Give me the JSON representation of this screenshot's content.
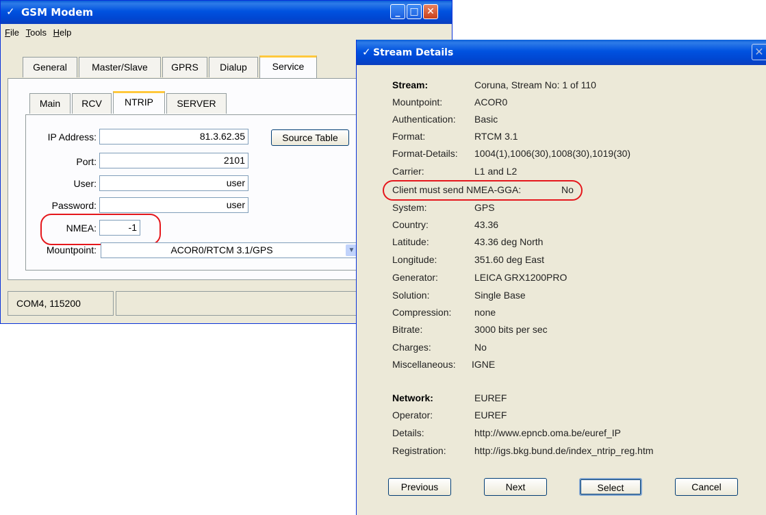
{
  "modem": {
    "title": "GSM Modem",
    "menu": [
      "File",
      "Tools",
      "Help"
    ],
    "tabs": [
      "General",
      "Master/Slave",
      "GPRS",
      "Dialup",
      "Service"
    ],
    "subtabs": [
      "Main",
      "RCV",
      "NTRIP",
      "SERVER"
    ],
    "ip_label": "IP Address:",
    "ip_value": "81.3.62.35",
    "source_table_label": "Source Table",
    "port_label": "Port:",
    "port_value": "2101",
    "user_label": "User:",
    "user_value": "user",
    "password_label": "Password:",
    "password_value": "user",
    "nmea_label": "NMEA:",
    "nmea_value": "-1",
    "mountpoint_label": "Mountpoint:",
    "mountpoint_value": "ACOR0/RTCM 3.1/GPS",
    "status": "COM4, 115200"
  },
  "stream": {
    "title": "Stream Details",
    "rows": [
      {
        "k": "Stream:",
        "v": "Coruna, Stream No:  1 of 110"
      },
      {
        "k": "Mountpoint:",
        "v": "ACOR0"
      },
      {
        "k": "Authentication:",
        "v": "Basic"
      },
      {
        "k": "Format:",
        "v": "RTCM 3.1"
      },
      {
        "k": "Format-Details:",
        "v": "1004(1),1006(30),1008(30),1019(30)"
      },
      {
        "k": "Carrier:",
        "v": "L1 and L2"
      },
      {
        "k": "Client must send NMEA-GGA:",
        "v": "No"
      },
      {
        "k": "System:",
        "v": "GPS"
      },
      {
        "k": "Country:",
        "v": "43.36"
      },
      {
        "k": "Latitude:",
        "v": "43.36 deg North"
      },
      {
        "k": "Longitude:",
        "v": "351.60 deg East"
      },
      {
        "k": "Generator:",
        "v": "LEICA GRX1200PRO"
      },
      {
        "k": "Solution:",
        "v": "Single Base"
      },
      {
        "k": "Compression:",
        "v": "none"
      },
      {
        "k": "Bitrate:",
        "v": "3000 bits per sec"
      },
      {
        "k": "Charges:",
        "v": "No"
      },
      {
        "k": "Miscellaneous:",
        "v": "IGNE"
      },
      {
        "k": "Network:",
        "v": "EUREF"
      },
      {
        "k": "Operator:",
        "v": "EUREF"
      },
      {
        "k": "Details:",
        "v": "http://www.epncb.oma.be/euref_IP"
      },
      {
        "k": "Registration:",
        "v": "http://igs.bkg.bund.de/index_ntrip_reg.htm"
      }
    ],
    "buttons": [
      "Previous",
      "Next",
      "Select",
      "Cancel"
    ]
  },
  "colors": {
    "highlight": "#e5161b",
    "titlebar": "#0052e0"
  }
}
